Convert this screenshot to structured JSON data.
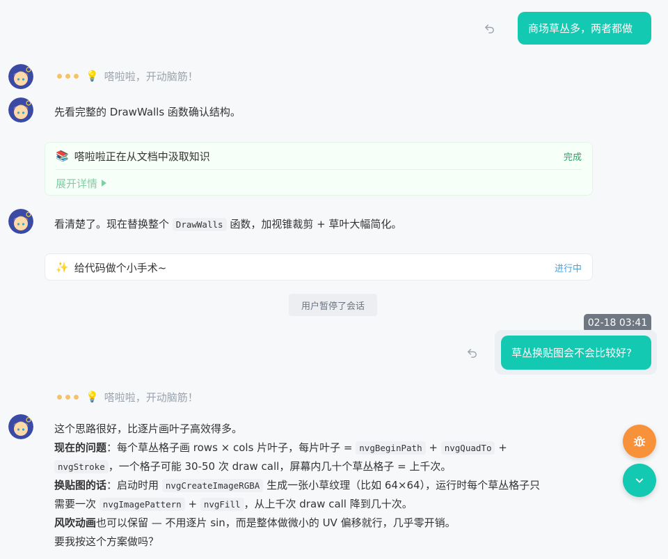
{
  "messages": {
    "user1": {
      "text": "商场草丛多，两者都做"
    },
    "thinking1": {
      "text": "嗒啦啦，开动脑筋！"
    },
    "ai1": {
      "text": "先看完整的 DrawWalls 函数确认结构。"
    },
    "tool1": {
      "title": "嗒啦啦正在从文档中汲取知识",
      "status": "完成",
      "expand_label": "展开详情"
    },
    "ai2": {
      "part1": "看清楚了。现在替换整个",
      "code": "DrawWalls",
      "part2": "函数，加视锥裁剪 + 草叶大幅简化。"
    },
    "tool2": {
      "title": "给代码做个小手术~",
      "status": "进行中"
    },
    "paused": {
      "text": "用户暂停了会话"
    },
    "timestamp": {
      "text": "02-18 03:41"
    },
    "user2": {
      "text": "草丛换贴图会不会比较好?"
    },
    "thinking2": {
      "text": "嗒啦啦，开动脑筋！"
    },
    "ai3": {
      "line1": "这个思路很好，比逐片画叶子高效得多。",
      "problem_label": "现在的问题",
      "problem_a": "：每个草丛格子画 rows × cols 片叶子，每片叶子 =",
      "code_begin": "nvgBeginPath",
      "plus1": "+",
      "code_quad": "nvgQuadTo",
      "plus2": "+",
      "code_stroke": "nvgStroke",
      "problem_b": "，一个格子可能 30-50 次 draw call，屏幕内几十个草丛格子 = 上千次。",
      "solution_label": "换贴图的话",
      "solution_a": "：启动时用",
      "code_create": "nvgCreateImageRGBA",
      "solution_b": "生成一张小草纹理（比如 64×64），运行时每个草丛格子只",
      "solution_c": "需要一次",
      "code_pattern": "nvgImagePattern",
      "plus3": "+",
      "code_fill": "nvgFill",
      "solution_d": "，从上千次 draw call 降到几十次。",
      "wind_label": "风吹动画",
      "wind_text": "也可以保留 — 不用逐片 sin，而是整体做微小的 UV 偏移就行，几乎零开销。",
      "question": "要我按这个方案做吗？"
    }
  },
  "icons": {
    "undo": "undo-icon",
    "bulb": "bulb-icon",
    "books": "books-icon",
    "sparkle": "sparkle-icon",
    "bug": "bug-icon",
    "chevron": "chevron-down-icon"
  },
  "colors": {
    "accent": "#14c9b1",
    "done": "#2e9e62",
    "running": "#4aa3d8",
    "bug_fab": "#f7923b",
    "thinking_dots": "#f2c36b"
  }
}
